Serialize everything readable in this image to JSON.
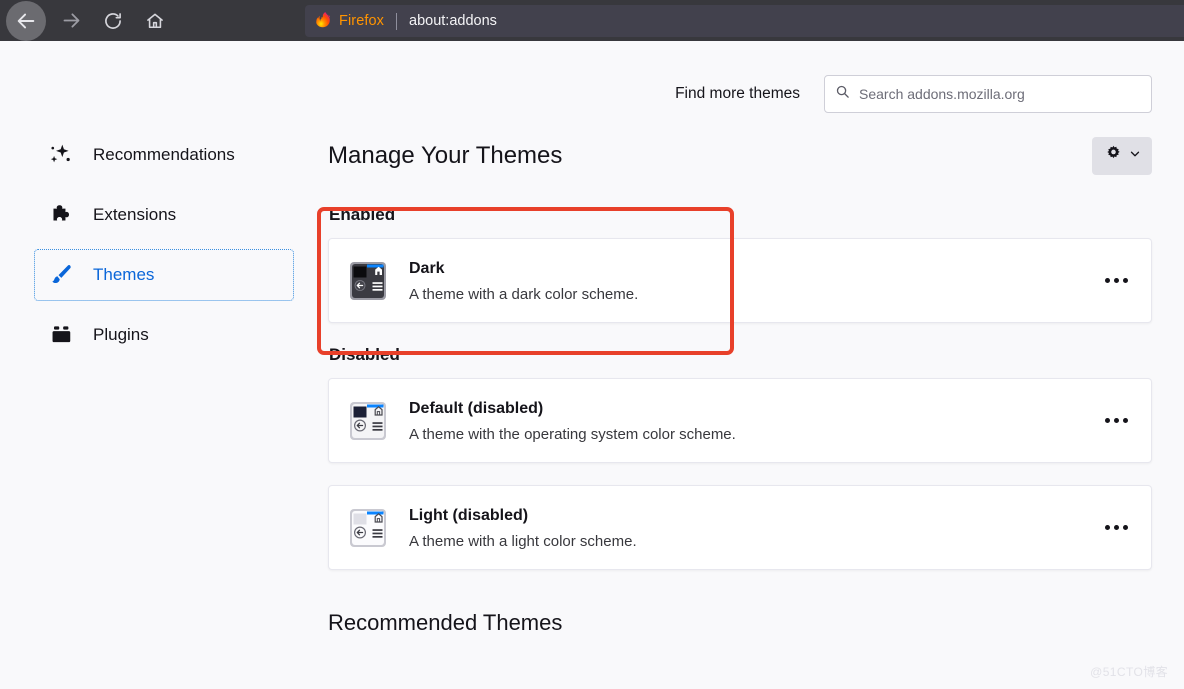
{
  "browser": {
    "back_icon": "back-arrow-icon",
    "forward_icon": "forward-arrow-icon",
    "reload_icon": "reload-icon",
    "home_icon": "home-icon",
    "brand_label": "Firefox",
    "url": "about:addons",
    "toolbar_bg": "#38383d",
    "urlbar_bg": "#42414d",
    "brand_color": "#ff9400"
  },
  "search": {
    "find_more_label": "Find more themes",
    "placeholder": "Search addons.mozilla.org",
    "value": "",
    "icon": "search-icon"
  },
  "sidebar": {
    "items": [
      {
        "label": "Recommendations",
        "icon": "sparkle-icon",
        "selected": false
      },
      {
        "label": "Extensions",
        "icon": "puzzle-piece-icon",
        "selected": false
      },
      {
        "label": "Themes",
        "icon": "paintbrush-icon",
        "selected": true
      },
      {
        "label": "Plugins",
        "icon": "plugin-icon",
        "selected": false
      }
    ],
    "selected_color": "#0a66d9"
  },
  "main": {
    "title": "Manage Your Themes",
    "gear": {
      "icon": "gear-icon",
      "chevron": "chevron-down-icon"
    },
    "sections": [
      {
        "heading": "Enabled",
        "themes": [
          {
            "name": "Dark",
            "description": "A theme with a dark color scheme.",
            "thumb": "dark-theme-thumbnail",
            "menu_icon": "more-options-icon"
          }
        ]
      },
      {
        "heading": "Disabled",
        "themes": [
          {
            "name": "Default (disabled)",
            "description": "A theme with the operating system color scheme.",
            "thumb": "default-theme-thumbnail",
            "menu_icon": "more-options-icon"
          },
          {
            "name": "Light (disabled)",
            "description": "A theme with a light color scheme.",
            "thumb": "light-theme-thumbnail",
            "menu_icon": "more-options-icon"
          }
        ]
      }
    ],
    "recommended_heading": "Recommended Themes"
  },
  "annotation": {
    "color": "#e8402a"
  },
  "watermark": "@51CTO博客"
}
